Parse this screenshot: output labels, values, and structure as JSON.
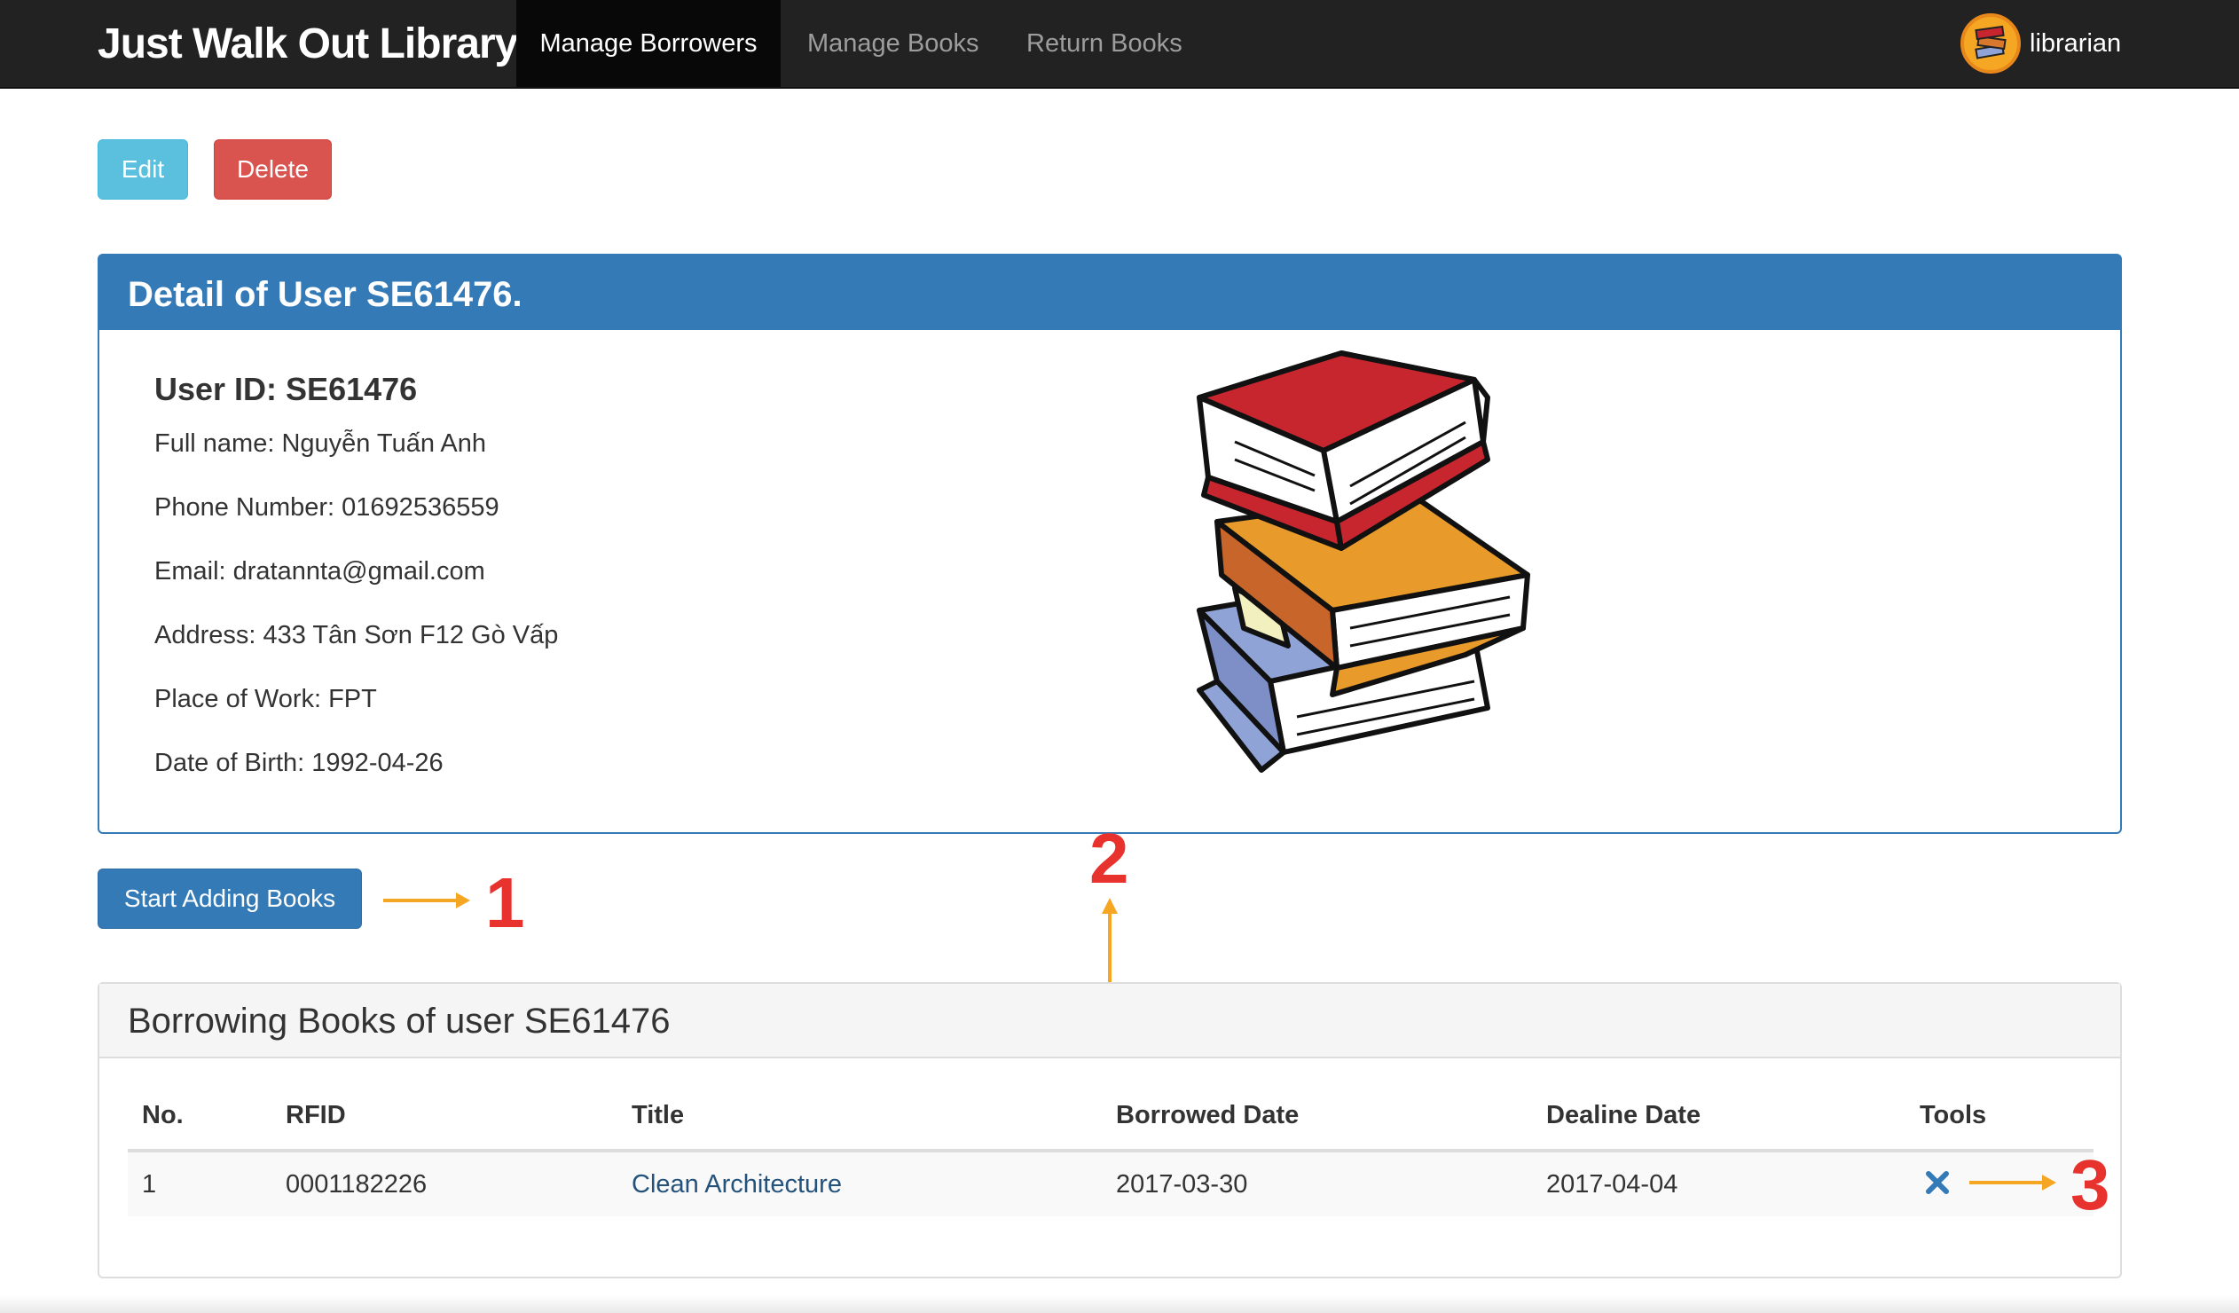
{
  "navbar": {
    "brand": "Just Walk Out Library",
    "items": [
      {
        "label": "Manage Borrowers",
        "active": true
      },
      {
        "label": "Manage Books",
        "active": false
      },
      {
        "label": "Return Books",
        "active": false
      }
    ],
    "user": "librarian"
  },
  "actions": {
    "edit_label": "Edit",
    "delete_label": "Delete",
    "start_adding_label": "Start Adding Books"
  },
  "detail": {
    "heading": "Detail of User SE61476.",
    "user_id": "User ID: SE61476",
    "full_name": "Full name: Nguyễn Tuấn Anh",
    "phone": "Phone Number: 01692536559",
    "email": "Email: dratannta@gmail.com",
    "address": "Address: 433 Tân Sơn F12 Gò Vấp",
    "place_of_work": "Place of Work: FPT",
    "date_of_birth": "Date of Birth: 1992-04-26"
  },
  "annotations": {
    "one": "1",
    "two": "2",
    "three": "3"
  },
  "borrowing": {
    "heading": "Borrowing Books of user SE61476",
    "columns": [
      "No.",
      "RFID",
      "Title",
      "Borrowed Date",
      "Dealine Date",
      "Tools"
    ],
    "rows": [
      {
        "no": "1",
        "rfid": "0001182226",
        "title": "Clean Architecture",
        "borrowed": "2017-03-30",
        "deadline": "2017-04-04"
      }
    ]
  },
  "colors": {
    "navbar": "#222222",
    "primary": "#337ab7",
    "info": "#5bc0de",
    "danger": "#d9534f",
    "annotation_red": "#e8322d",
    "annotation_arrow": "#f5a623"
  },
  "icons": {
    "remove": "times-icon",
    "avatar": "books-avatar-icon",
    "illustration": "book-stack-illustration"
  }
}
